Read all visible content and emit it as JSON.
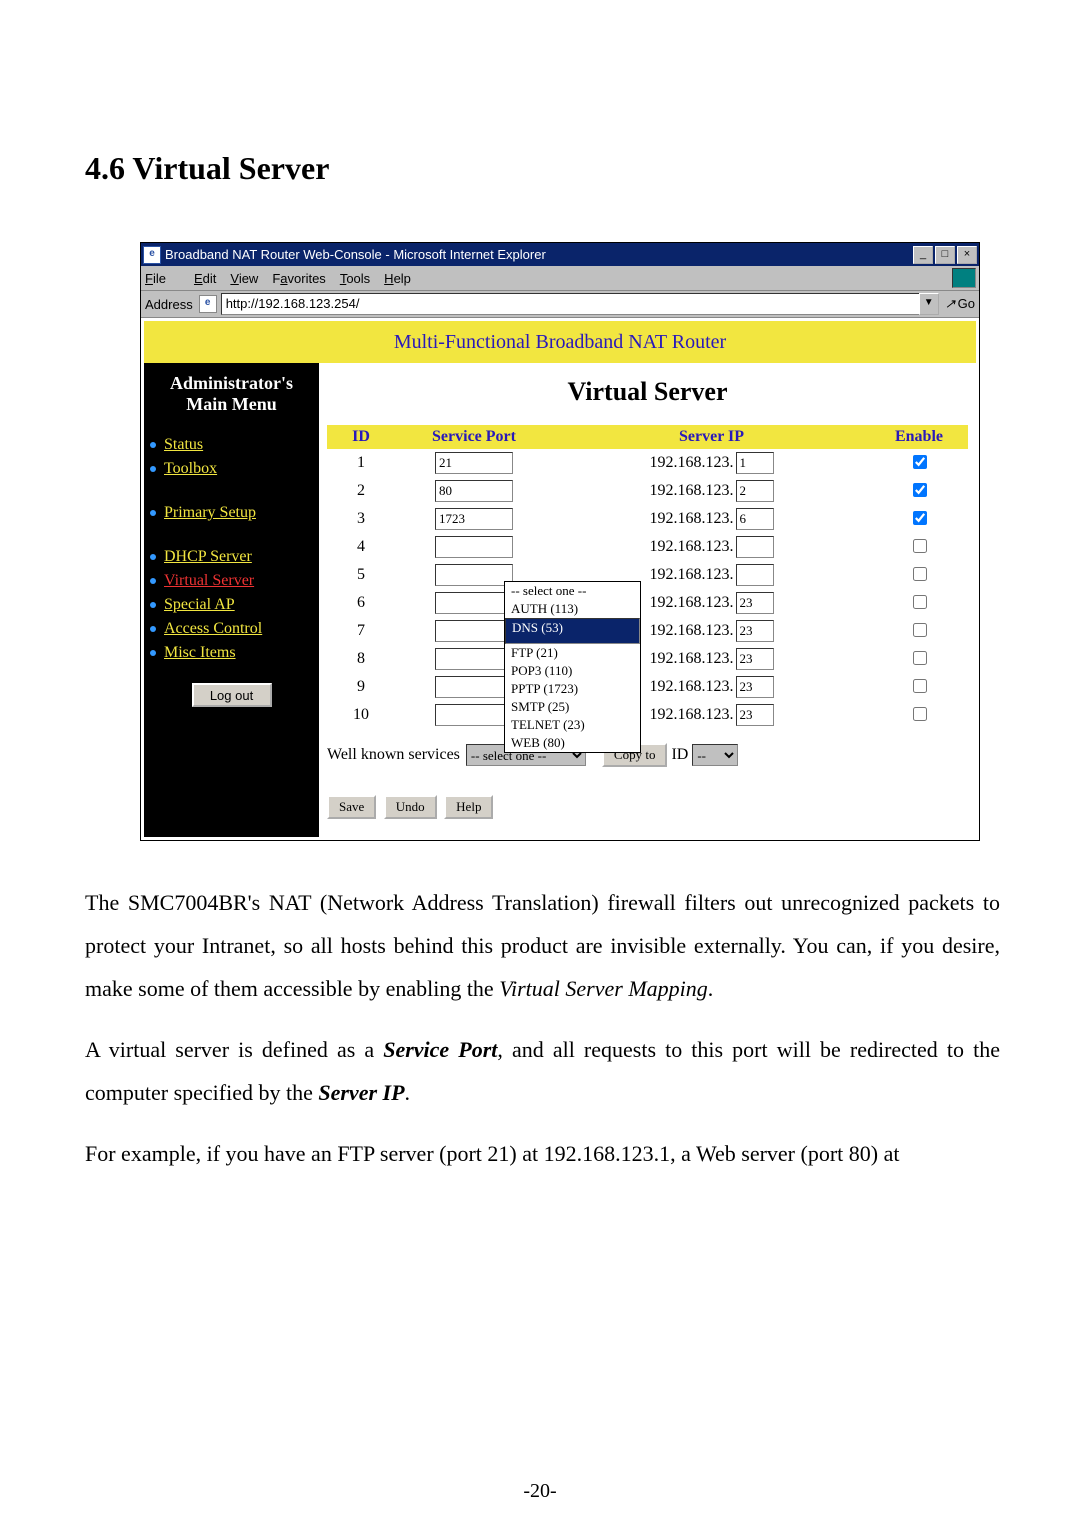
{
  "doc": {
    "section_title": "4.6 Virtual Server",
    "page_number": "-20-",
    "para1_a": "The SMC7004BR's NAT (Network Address Translation) firewall filters out unrecognized packets to protect your Intranet, so all hosts behind this product are invisible externally. You can, if you desire, make some of them accessible by enabling the ",
    "para1_em": "Virtual Server Mapping",
    "para1_b": ".",
    "para2_a": "A virtual server is defined as a ",
    "para2_em1": "Service Port",
    "para2_b": ", and all requests to this port will be redirected to the computer specified by the ",
    "para2_em2": "Server IP",
    "para2_c": ".",
    "para3": "For example, if you have an FTP server (port 21) at 192.168.123.1, a Web server (port 80) at"
  },
  "window": {
    "title": "Broadband NAT Router Web-Console - Microsoft Internet Explorer",
    "menus": {
      "file": "File",
      "edit": "Edit",
      "view": "View",
      "fav": "Favorites",
      "tools": "Tools",
      "help": "Help"
    },
    "address_label": "Address",
    "address_url": "http://192.168.123.254/",
    "go_label": "Go",
    "btn_min": "_",
    "btn_max": "□",
    "btn_close": "×"
  },
  "router": {
    "banner": "Multi-Functional Broadband NAT Router",
    "side_header": "Administrator's Main Menu",
    "nav": {
      "status": "Status",
      "toolbox": "Toolbox",
      "primary": "Primary Setup",
      "dhcp": "DHCP Server",
      "virtual": "Virtual Server",
      "special": "Special AP",
      "access": "Access Control",
      "misc": "Misc Items"
    },
    "logout": "Log out",
    "page_title": "Virtual Server",
    "cols": {
      "id": "ID",
      "port": "Service Port",
      "ip": "Server IP",
      "enable": "Enable"
    },
    "ip_prefix": "192.168.123.",
    "rows": [
      {
        "id": "1",
        "port": "21",
        "last": "1",
        "en": true
      },
      {
        "id": "2",
        "port": "80",
        "last": "2",
        "en": true
      },
      {
        "id": "3",
        "port": "1723",
        "last": "6",
        "en": true
      },
      {
        "id": "4",
        "port": "",
        "last": "",
        "en": false
      },
      {
        "id": "5",
        "port": "",
        "last": "",
        "en": false
      },
      {
        "id": "6",
        "port": "",
        "last": "23",
        "en": false
      },
      {
        "id": "7",
        "port": "",
        "last": "23",
        "en": false
      },
      {
        "id": "8",
        "port": "",
        "last": "23",
        "en": false
      },
      {
        "id": "9",
        "port": "",
        "last": "23",
        "en": false
      },
      {
        "id": "10",
        "port": "",
        "last": "23",
        "en": false
      }
    ],
    "wk_label": "Well known services",
    "wk_selected": "-- select one --",
    "wk_options": [
      "-- select one --",
      "AUTH (113)",
      "DNS (53)",
      "FTP (21)",
      "POP3 (110)",
      "PPTP (1723)",
      "SMTP (25)",
      "TELNET (23)",
      "WEB (80)"
    ],
    "copy_to": "Copy to",
    "id_label": "ID",
    "id_sel": "--",
    "btn_save": "Save",
    "btn_undo": "Undo",
    "btn_help": "Help"
  }
}
